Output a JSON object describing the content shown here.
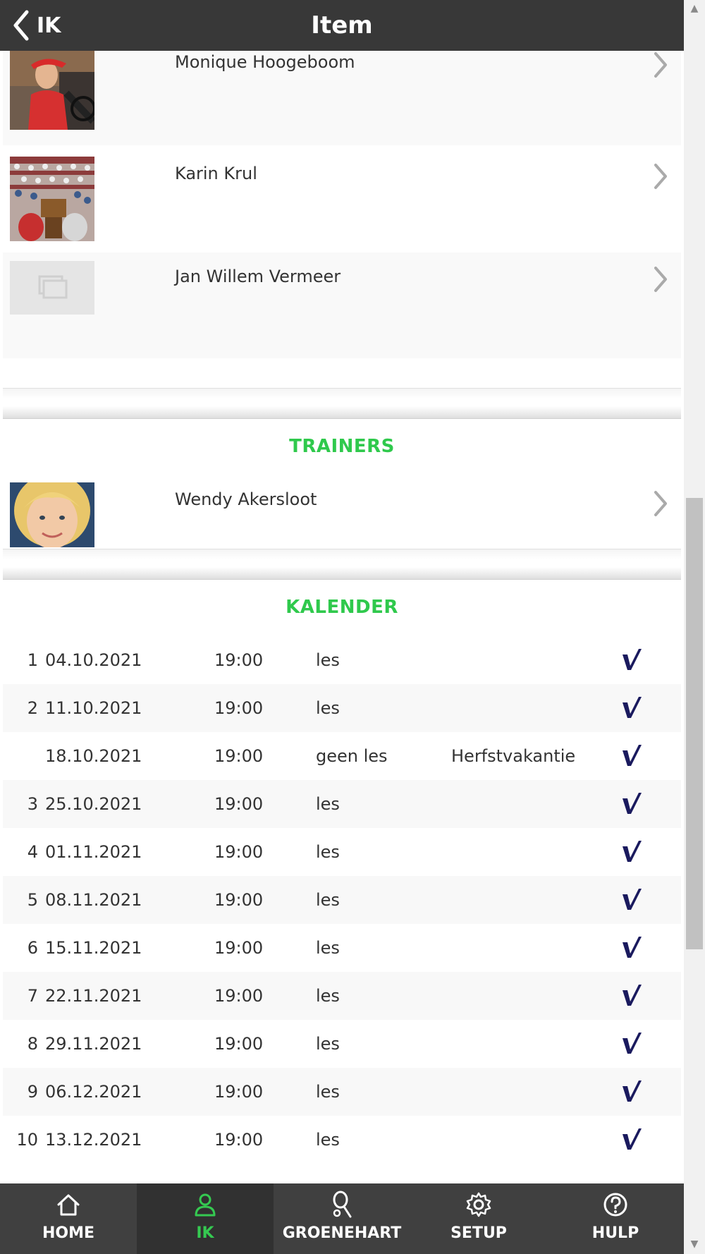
{
  "header": {
    "back_label": "IK",
    "title": "Item"
  },
  "members": [
    {
      "name": "Monique Hoogeboom",
      "photo": "player-photo"
    },
    {
      "name": "Karin Krul",
      "photo": "crowd-photo"
    },
    {
      "name": "Jan Willem Vermeer",
      "photo": "placeholder"
    }
  ],
  "trainers_title": "TRAINERS",
  "trainers": [
    {
      "name": "Wendy Akersloot"
    }
  ],
  "calendar_title": "KALENDER",
  "calendar": [
    {
      "num": "1",
      "date": "04.10.2021",
      "time": "19:00",
      "type": "les",
      "note": ""
    },
    {
      "num": "2",
      "date": "11.10.2021",
      "time": "19:00",
      "type": "les",
      "note": ""
    },
    {
      "num": "",
      "date": "18.10.2021",
      "time": "19:00",
      "type": "geen les",
      "note": "Herfstvakantie"
    },
    {
      "num": "3",
      "date": "25.10.2021",
      "time": "19:00",
      "type": "les",
      "note": ""
    },
    {
      "num": "4",
      "date": "01.11.2021",
      "time": "19:00",
      "type": "les",
      "note": ""
    },
    {
      "num": "5",
      "date": "08.11.2021",
      "time": "19:00",
      "type": "les",
      "note": ""
    },
    {
      "num": "6",
      "date": "15.11.2021",
      "time": "19:00",
      "type": "les",
      "note": ""
    },
    {
      "num": "7",
      "date": "22.11.2021",
      "time": "19:00",
      "type": "les",
      "note": ""
    },
    {
      "num": "8",
      "date": "29.11.2021",
      "time": "19:00",
      "type": "les",
      "note": ""
    },
    {
      "num": "9",
      "date": "06.12.2021",
      "time": "19:00",
      "type": "les",
      "note": ""
    },
    {
      "num": "10",
      "date": "13.12.2021",
      "time": "19:00",
      "type": "les",
      "note": ""
    }
  ],
  "nav": [
    {
      "label": "HOME",
      "icon": "home-icon",
      "active": false
    },
    {
      "label": "IK",
      "icon": "user-icon",
      "active": true
    },
    {
      "label": "GROENEHART",
      "icon": "tennis-racket-icon",
      "active": false
    },
    {
      "label": "SETUP",
      "icon": "gear-icon",
      "active": false
    },
    {
      "label": "HULP",
      "icon": "help-icon",
      "active": false
    }
  ],
  "colors": {
    "header_bg": "#383838",
    "accent": "#2fc94c",
    "check": "#1a1a5e",
    "nav_bg": "#3a3a3a"
  }
}
